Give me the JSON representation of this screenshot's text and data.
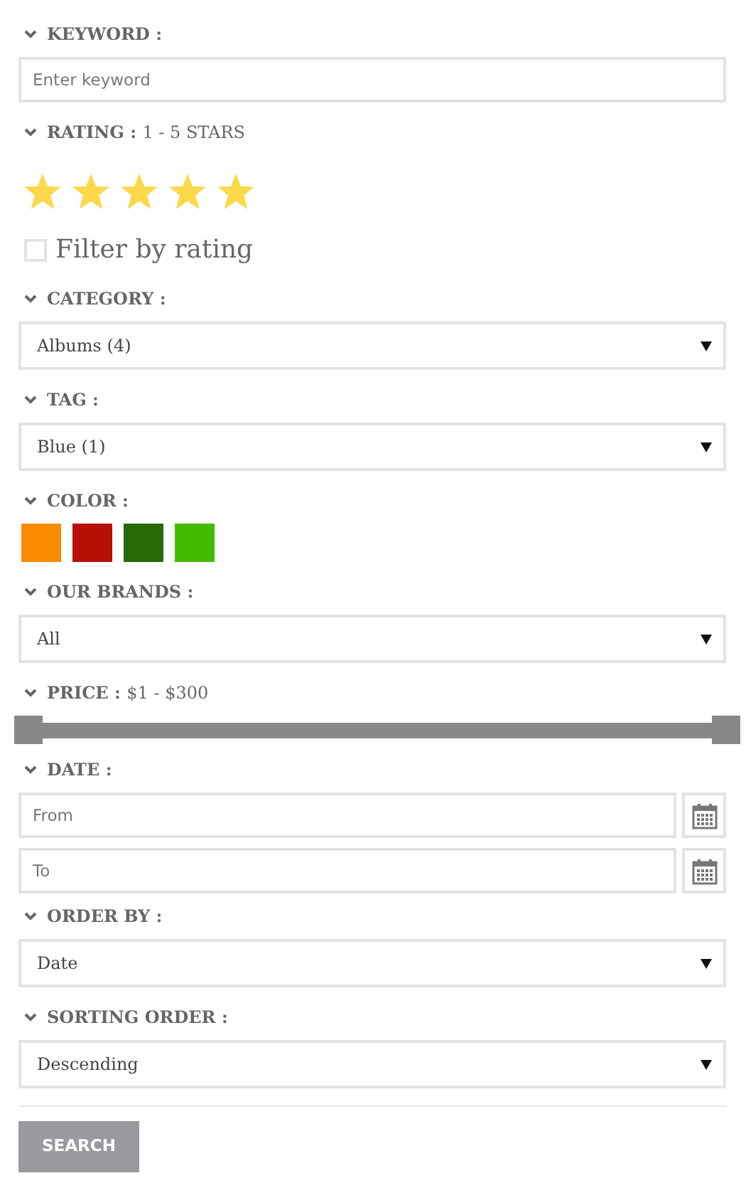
{
  "sections": [
    {
      "kind": "text",
      "label": "KEYWORD :",
      "placeholder": "Enter keyword"
    },
    {
      "kind": "stars",
      "label": "RATING :",
      "note": "1 - 5 STARS",
      "stars": 5,
      "checkbox": {
        "label": "Filter by rating",
        "checked": false
      }
    },
    {
      "kind": "select",
      "label": "CATEGORY :",
      "value": "Albums (4)"
    },
    {
      "kind": "select",
      "label": "TAG :",
      "value": "Blue (1)"
    },
    {
      "kind": "colors",
      "label": "COLOR :",
      "swatches": [
        {
          "color": "#fb8c00"
        },
        {
          "color": "#b71105"
        },
        {
          "color": "#286a04"
        },
        {
          "color": "#45bb02"
        }
      ]
    },
    {
      "kind": "select",
      "label": "OUR BRANDS :",
      "value": "All"
    },
    {
      "kind": "range",
      "label": "PRICE :",
      "note": "$1 - $300"
    },
    {
      "kind": "dates",
      "label": "DATE :",
      "fields": [
        {
          "placeholder": "From"
        },
        {
          "placeholder": "To"
        }
      ]
    },
    {
      "kind": "select",
      "label": "ORDER BY :",
      "value": "Date"
    },
    {
      "kind": "select",
      "label": "SORTING ORDER :",
      "value": "Descending"
    }
  ],
  "button": "SEARCH"
}
